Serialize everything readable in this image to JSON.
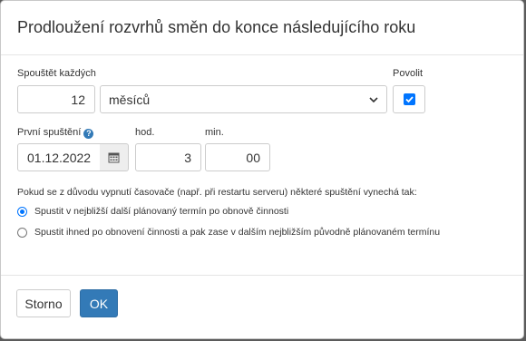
{
  "dialog": {
    "title": "Prodloužení rozvrhů směn do konce následujícího roku"
  },
  "schedule": {
    "every_label": "Spouštět každých",
    "every_value": "12",
    "unit_selected": "měsíců",
    "enable_label": "Povolit",
    "enabled": true
  },
  "first_run": {
    "label": "První spuštění",
    "help_icon": "question-icon",
    "date_value": "01.12.2022",
    "hour_label": "hod.",
    "hour_value": "3",
    "minute_label": "min.",
    "minute_value": "00"
  },
  "missed": {
    "prompt": "Pokud se z důvodu vypnutí časovače (např. při restartu serveru) některé spuštění vynechá tak:",
    "options": [
      {
        "label": "Spustit v nejbližší další plánovaný termín po obnově činnosti",
        "selected": true
      },
      {
        "label": "Spustit ihned po obnovení činnosti a pak zase v dalším nejbližším původně plánovaném termínu",
        "selected": false
      }
    ]
  },
  "footer": {
    "cancel_label": "Storno",
    "ok_label": "OK"
  },
  "colors": {
    "primary": "#337ab7",
    "checkbox": "#0075ff"
  }
}
